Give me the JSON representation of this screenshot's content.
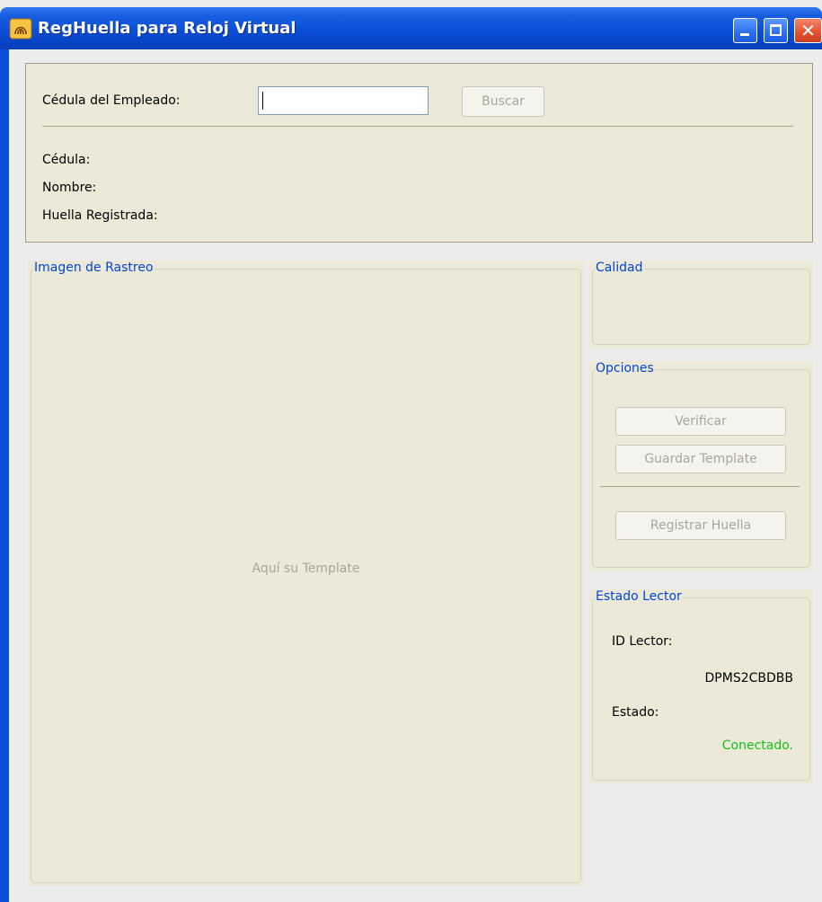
{
  "window": {
    "title": "RegHuella para Reloj Virtual",
    "close_glyph": "✕"
  },
  "search": {
    "cedula_label": "Cédula del Empleado:",
    "cedula_value": "",
    "buscar_label": "Buscar"
  },
  "info": {
    "cedula_label": "Cédula:",
    "nombre_label": "Nombre:",
    "huella_label": "Huella Registrada:"
  },
  "imagen": {
    "legend": "Imagen de Rastreo",
    "placeholder": "Aquí su Template"
  },
  "calidad": {
    "legend": "Calidad"
  },
  "opciones": {
    "legend": "Opciones",
    "verificar_label": "Verificar",
    "guardar_label": "Guardar Template",
    "registrar_label": "Registrar Huella"
  },
  "estado": {
    "legend": "Estado Lector",
    "id_label": "ID Lector:",
    "id_value": "DPMS2CBDBB",
    "estado_label": "Estado:",
    "estado_value": "Conectado."
  },
  "colors": {
    "title_bar": "#0a4fd8",
    "legend_text": "#0046d5",
    "connected": "#12c21a",
    "panel": "#ece9d8"
  },
  "icons": {
    "app": "fingerprint-app-icon",
    "minimize": "minimize-icon",
    "maximize": "maximize-icon",
    "close": "close-icon"
  }
}
